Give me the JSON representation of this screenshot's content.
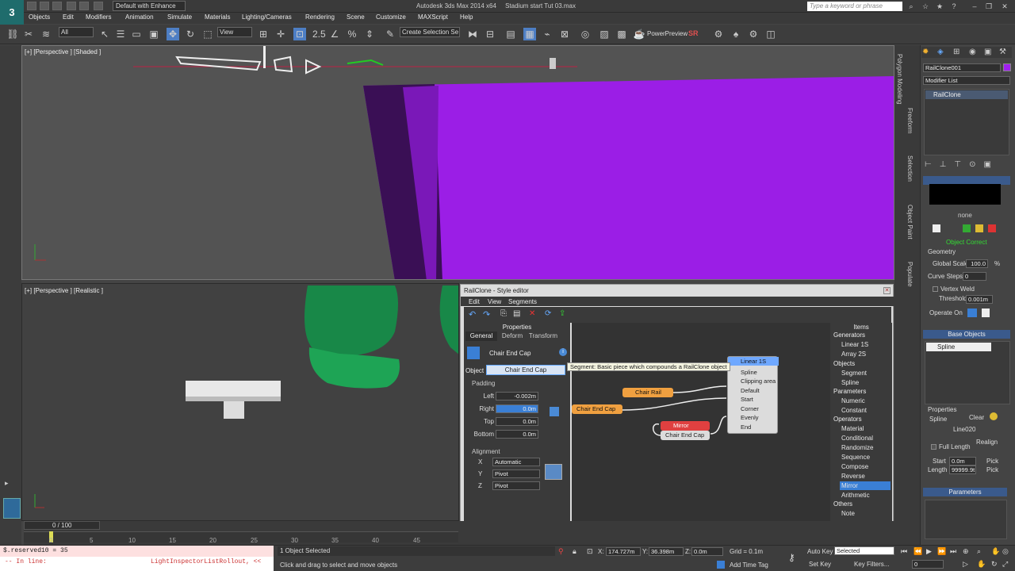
{
  "titlebar": {
    "workspace": "Default with Enhance",
    "app_title": "Autodesk 3ds Max 2014 x64",
    "file_title": "Stadium start Tut 03.max",
    "search_placeholder": "Type a keyword or phrase"
  },
  "menus": [
    "Objects",
    "Edit",
    "Modifiers",
    "Animation",
    "Simulate",
    "Materials",
    "Lighting/Cameras",
    "Rendering",
    "Scene",
    "Customize",
    "MAXScript",
    "Help"
  ],
  "toolbar": {
    "selection_filter": "All",
    "ref_coord": "View",
    "named_selection": "Create Selection Se",
    "power_preview": "PowerPreview",
    "sr_label": "SR"
  },
  "viewports": {
    "top_label": "[+] [Perspective ] [Shaded ]",
    "bottom_label": "[+] [Perspective ] [Realistic ]"
  },
  "ribbon_tabs": [
    "Polygon Modeling",
    "Freeform",
    "Selection",
    "Object Paint",
    "Populate"
  ],
  "command_panel": {
    "object_name": "RailClone001",
    "modifier_list": "Modifier List",
    "stack_item": "RailClone",
    "preview_label": "none",
    "object_status": "Object Correct",
    "geometry_label": "Geometry",
    "global_scale_label": "Global Scale",
    "global_scale_value": "100.0",
    "global_scale_unit": "%",
    "curve_steps_label": "Curve Steps",
    "curve_steps_value": "0",
    "vertex_weld_label": "Vertex Weld",
    "threshold_label": "Threshold",
    "threshold_value": "0.001m",
    "operate_on_label": "Operate On",
    "base_objects_header": "Base Objects",
    "base_objects_item": "Spline",
    "properties_label": "Properties",
    "spline_label": "Spline",
    "clear_button": "Clear",
    "spline_value": "Line020",
    "realign_button": "Realign",
    "full_length_label": "Full Length",
    "start_label": "Start",
    "start_value": "0.0m",
    "length_label": "Length",
    "length_value": "99999.9t",
    "pick_label": "Pick",
    "parameters_header": "Parameters"
  },
  "style_editor": {
    "title": "RailClone - Style editor",
    "menus": [
      "Edit",
      "View",
      "Segments"
    ],
    "properties_header": "Properties",
    "tabs": [
      "General",
      "Deform",
      "Transform"
    ],
    "segment_name": "Chair End Cap",
    "object_label": "Object",
    "object_value": "Chair End Cap",
    "padding_label": "Padding",
    "padding": [
      {
        "label": "Left",
        "value": "-0.002m"
      },
      {
        "label": "Right",
        "value": "0.0m"
      },
      {
        "label": "Top",
        "value": "0.0m"
      },
      {
        "label": "Bottom",
        "value": "0.0m"
      }
    ],
    "alignment_label": "Alignment",
    "alignment": [
      {
        "axis": "X",
        "value": "Automatic"
      },
      {
        "axis": "Y",
        "value": "Pivot"
      },
      {
        "axis": "Z",
        "value": "Pivot"
      }
    ],
    "tooltip": "Segment: Basic piece which compounds a RailClone object",
    "nodes": {
      "generator_title": "Linear 1S",
      "generator_ports": [
        "Spline",
        "Clipping area",
        "Default",
        "Start",
        "Corner",
        "Evenly",
        "End"
      ],
      "chair_rail": "Chair Rail",
      "chair_end_cap_left": "Chair End Cap",
      "mirror": "Mirror",
      "mirror_input": "Chair End Cap"
    },
    "items_header": "Items",
    "items": [
      {
        "type": "head",
        "label": "Generators"
      },
      {
        "type": "item",
        "label": "Linear 1S"
      },
      {
        "type": "item",
        "label": "Array 2S"
      },
      {
        "type": "head",
        "label": "Objects"
      },
      {
        "type": "item",
        "label": "Segment"
      },
      {
        "type": "item",
        "label": "Spline"
      },
      {
        "type": "head",
        "label": "Parameters"
      },
      {
        "type": "item",
        "label": "Numeric"
      },
      {
        "type": "item",
        "label": "Constant"
      },
      {
        "type": "head",
        "label": "Operators"
      },
      {
        "type": "item",
        "label": "Material"
      },
      {
        "type": "item",
        "label": "Conditional"
      },
      {
        "type": "item",
        "label": "Randomize"
      },
      {
        "type": "item",
        "label": "Sequence"
      },
      {
        "type": "item",
        "label": "Compose"
      },
      {
        "type": "item",
        "label": "Reverse"
      },
      {
        "type": "item",
        "label": "Mirror",
        "selected": true
      },
      {
        "type": "item",
        "label": "Arithmetic"
      },
      {
        "type": "head",
        "label": "Others"
      },
      {
        "type": "item",
        "label": "Note"
      }
    ]
  },
  "timeline": {
    "frame_label": "0 / 100",
    "ticks": [
      "0",
      "5",
      "10",
      "15",
      "20",
      "25",
      "30",
      "35",
      "40",
      "45"
    ]
  },
  "status": {
    "listener_line1": "$.reserved10 = 35",
    "listener_line2_left": "-- In line:",
    "listener_line2_right": "LightInspectorListRollout, <<",
    "selection_status": "1 Object Selected",
    "prompt": "Click and drag to select and move objects",
    "x_label": "X:",
    "x_value": "174.727m",
    "y_label": "Y:",
    "y_value": "36.398m",
    "z_label": "Z:",
    "z_value": "0.0m",
    "grid": "Grid = 0.1m",
    "add_time_tag": "Add Time Tag",
    "auto_key": "Auto Key",
    "auto_key_value": "Selected",
    "set_key": "Set Key",
    "key_filters": "Key Filters...",
    "frame_value": "0"
  },
  "colors": {
    "accent_blue": "#3a7fd5",
    "bench_purple": "#a020f0",
    "chair_green": "#1a8a4a",
    "node_orange": "#f0a040",
    "node_red": "#e04040",
    "generator_blue": "#6fa8ff"
  }
}
